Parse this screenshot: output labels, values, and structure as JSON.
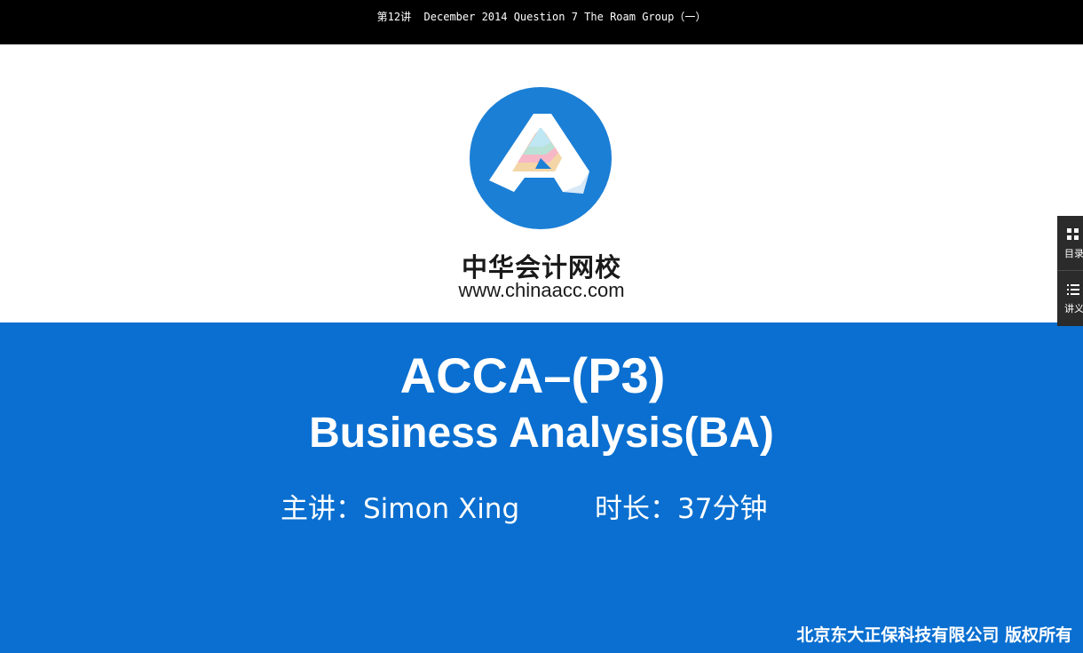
{
  "window": {
    "title": "第12讲  December 2014 Question 7 The Roam Group（一）"
  },
  "slide": {
    "brand_name_cn": "中华会计网校",
    "brand_url": "www.chinaacc.com",
    "course_code": "ACCA–(P3)",
    "course_name": "Business Analysis(BA)",
    "lecturer": "主讲：Simon Xing",
    "duration": "时长：37分钟",
    "copyright": "北京东大正保科技有限公司  版权所有",
    "colors": {
      "banner_blue": "#0a6fd0",
      "logo_blue": "#1b7fd6"
    }
  },
  "sidebar": {
    "items": [
      {
        "label": "目录",
        "icon": "grid-icon"
      },
      {
        "label": "讲义",
        "icon": "list-icon"
      }
    ]
  }
}
